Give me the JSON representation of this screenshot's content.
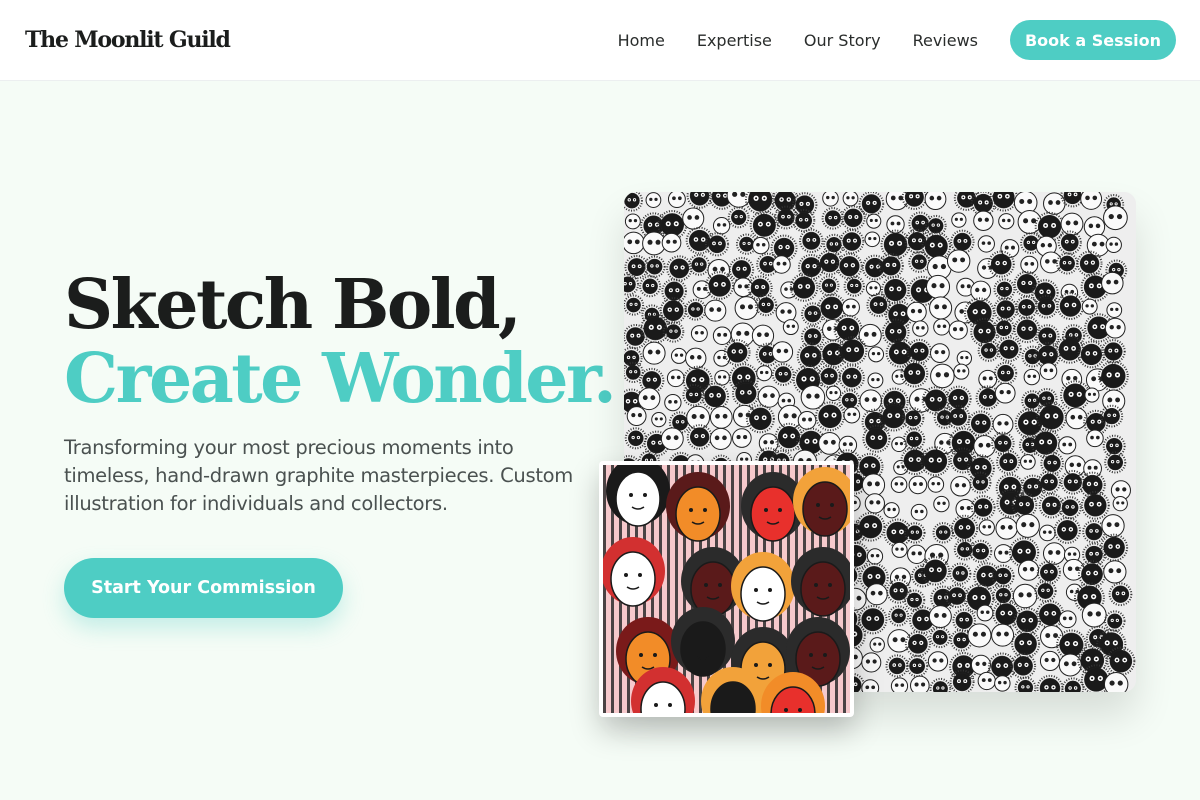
{
  "brand": {
    "name": "The Moonlit Guild"
  },
  "nav": {
    "links": [
      "Home",
      "Expertise",
      "Our Story",
      "Reviews"
    ],
    "cta_label": "Book a Session"
  },
  "hero": {
    "title_line1": "Sketch Bold,",
    "title_line2": "Create Wonder.",
    "subtitle": "Transforming your most precious moments into timeless, hand-drawn graphite masterpieces. Custom illustration for individuals and collectors.",
    "cta_label": "Start Your Commission"
  },
  "gallery": {
    "main_image": "soot-sprite-doodle-artwork",
    "secondary_image": "colorful-faces-illustration"
  },
  "colors": {
    "accent": "#4ecdc4",
    "heading": "#1b1d1c",
    "body_text": "#4a5150",
    "page_background": "#f5fcf6",
    "header_background": "#ffffff"
  }
}
